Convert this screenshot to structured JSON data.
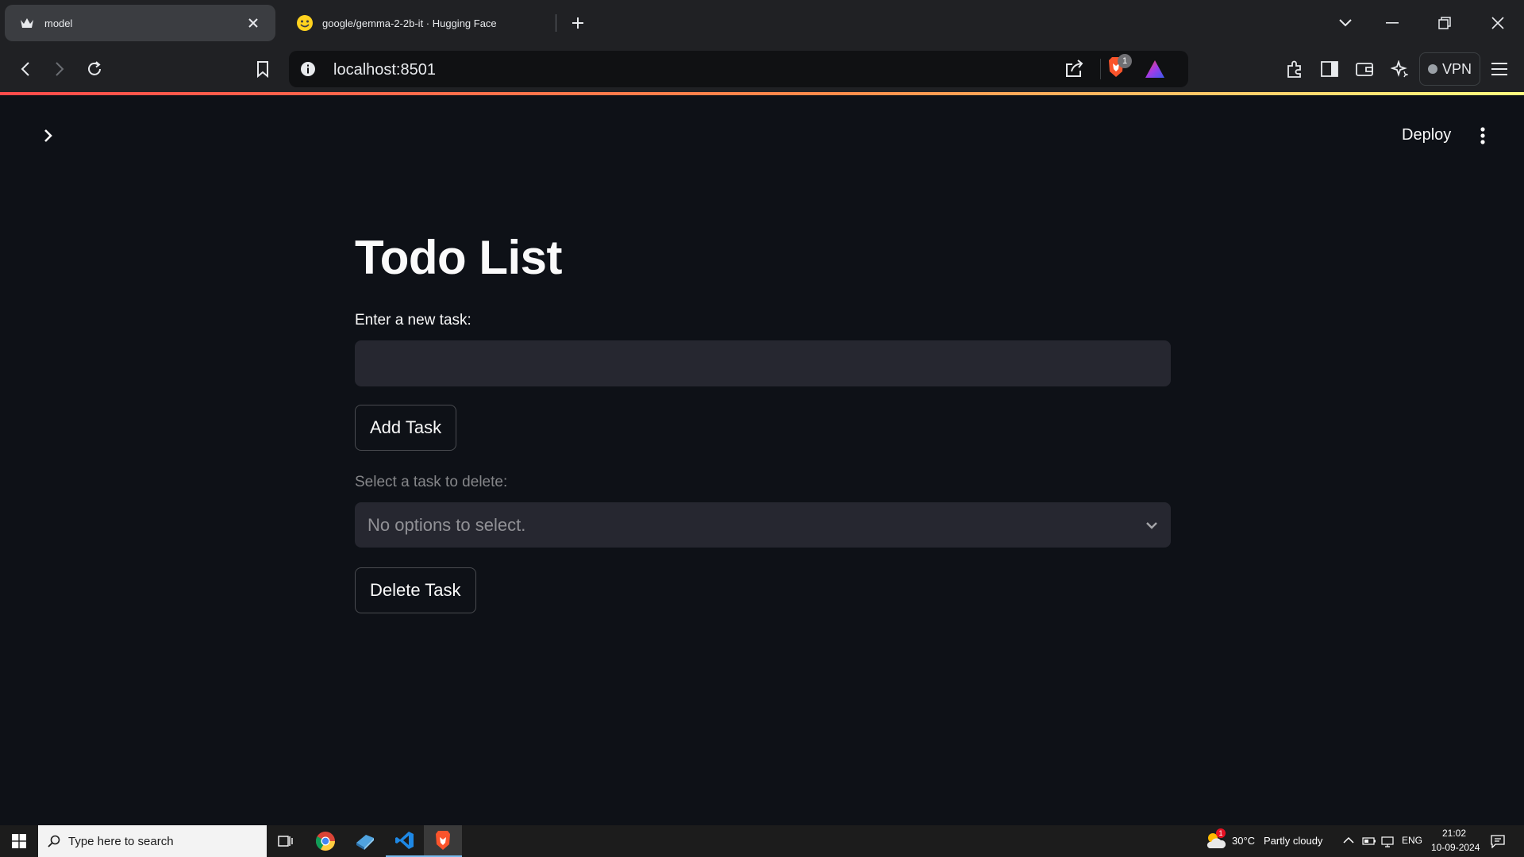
{
  "browser": {
    "tabs": [
      {
        "title": "model",
        "active": true
      },
      {
        "title": "google/gemma-2-2b-it · Hugging Face",
        "active": false
      }
    ],
    "url": "localhost:8501",
    "shields_badge": "1",
    "vpn_label": "VPN"
  },
  "app": {
    "deploy_label": "Deploy",
    "title": "Todo List",
    "task_input": {
      "label": "Enter a new task:",
      "value": "",
      "placeholder": ""
    },
    "add_button": "Add Task",
    "delete_select": {
      "label": "Select a task to delete:",
      "placeholder": "No options to select."
    },
    "delete_button": "Delete Task"
  },
  "taskbar": {
    "search_placeholder": "Type here to search",
    "weather": {
      "temp": "30°C",
      "condition": "Partly cloudy",
      "badge": "1"
    },
    "language": "ENG",
    "time": "21:02",
    "date": "10-09-2024"
  },
  "colors": {
    "app_bg": "#0e1117",
    "input_bg": "#262730",
    "browser_chrome": "#202124",
    "accent_red": "#ff4b4b",
    "vscode_blue": "#1e88e5",
    "brave_orange": "#fb542b"
  }
}
